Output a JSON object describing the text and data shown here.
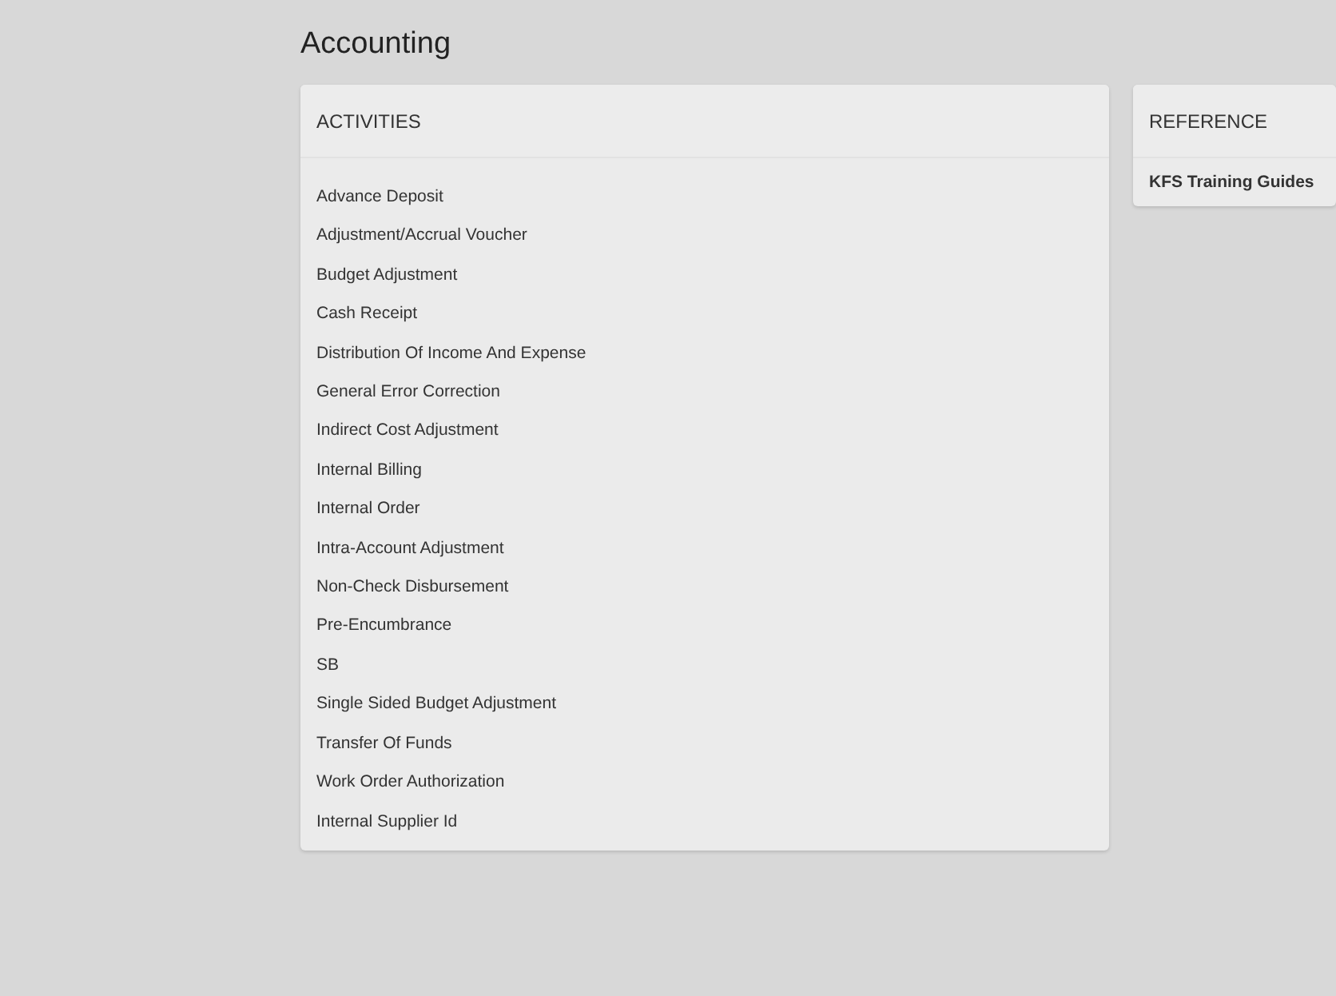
{
  "page_title": "Accounting",
  "activities": {
    "heading": "ACTIVITIES",
    "items": [
      "Advance Deposit",
      "Adjustment/Accrual Voucher",
      "Budget Adjustment",
      "Cash Receipt",
      "Distribution Of Income And Expense",
      "General Error Correction",
      "Indirect Cost Adjustment",
      "Internal Billing",
      "Internal Order",
      "Intra-Account Adjustment",
      "Non-Check Disbursement",
      "Pre-Encumbrance",
      "SB",
      "Single Sided Budget Adjustment",
      "Transfer Of Funds",
      "Work Order Authorization",
      "Internal Supplier Id"
    ]
  },
  "reference": {
    "heading": "REFERENCE",
    "items": [
      "KFS Training Guides"
    ]
  }
}
